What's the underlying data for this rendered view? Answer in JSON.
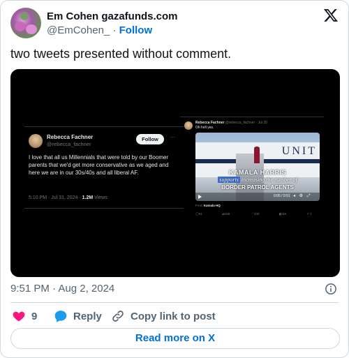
{
  "author": {
    "name": "Em Cohen gazafunds.com",
    "handle": "@EmCohen_",
    "separator": "·",
    "follow_label": "Follow"
  },
  "tweet": {
    "text": "two tweets presented without comment.",
    "timestamp": "9:51 PM · Aug 2, 2024"
  },
  "embed_left": {
    "name": "Rebecca Fachner",
    "handle": "@rebecca_fachner",
    "follow_label": "Follow",
    "more": "···",
    "text": "I love that all us Millennials that were told by our Boomer parents that we'd get more conservative as we aged and here we are in our 30s/40s and all liberal AF.",
    "meta_time": "5:10 PM · Jul 31, 2024 · ",
    "views_count": "1.2M",
    "views_label": " Views"
  },
  "embed_right": {
    "name": "Rebecca Fachner",
    "handle_time": "@rebecca_fachner · Jul 30",
    "text": "Oh hell yes.",
    "video_caption_1": "KAMALA HARRIS",
    "video_caption_2_highlight": "supports",
    "video_caption_2_rest": " increasing the number of",
    "video_caption_3": "BORDER PATROL AGENTS",
    "plane_text": "UNIT",
    "video_time": "0:05 / 0:51",
    "from_label": "From ",
    "from_source": "Kamala HQ",
    "replies": "91",
    "reposts": "189",
    "likes": "440",
    "views": "24K"
  },
  "actions": {
    "likes_count": "9",
    "reply_label": "Reply",
    "copy_label": "Copy link to post"
  },
  "read_more_label": "Read more on X",
  "colors": {
    "link": "#006fd6",
    "heart": "#f91880",
    "reply": "#1d9bf0"
  }
}
